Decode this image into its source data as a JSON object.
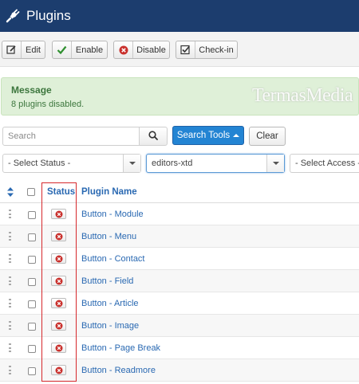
{
  "header": {
    "title": "Plugins",
    "icon": "plug-icon"
  },
  "toolbar": {
    "edit_label": "Edit",
    "enable_label": "Enable",
    "disable_label": "Disable",
    "checkin_label": "Check-in"
  },
  "message": {
    "title": "Message",
    "text": "8 plugins disabled."
  },
  "watermark": "TermasMedia",
  "search": {
    "placeholder": "Search",
    "tools_label": "Search Tools",
    "clear_label": "Clear"
  },
  "filters": {
    "status": "- Select Status -",
    "folder": "editors-xtd",
    "access": "- Select Access -"
  },
  "table": {
    "col_status": "Status",
    "col_name": "Plugin Name",
    "rows": [
      {
        "name": "Button - Module",
        "status": "disabled"
      },
      {
        "name": "Button - Menu",
        "status": "disabled"
      },
      {
        "name": "Button - Contact",
        "status": "disabled"
      },
      {
        "name": "Button - Field",
        "status": "disabled"
      },
      {
        "name": "Button - Article",
        "status": "disabled"
      },
      {
        "name": "Button - Image",
        "status": "disabled"
      },
      {
        "name": "Button - Page Break",
        "status": "disabled"
      },
      {
        "name": "Button - Readmore",
        "status": "disabled"
      }
    ]
  },
  "colors": {
    "header_bg": "#1c3d6e",
    "accent_blue": "#2384d3",
    "link": "#2a69b2",
    "success_bg": "#dff0d8",
    "success_text": "#3c763d",
    "disabled_icon": "#c9302c",
    "highlight": "#d6282c"
  }
}
